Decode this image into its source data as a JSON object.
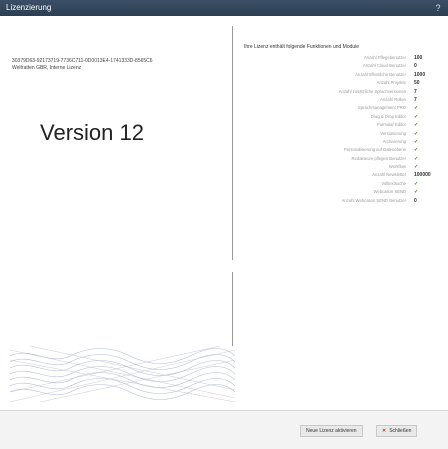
{
  "window": {
    "title": "Lizenzierung",
    "help_glyph": "?"
  },
  "license": {
    "key": "30379D63-92173719-7736C711-0D0013E4-1741333D-8565C6",
    "holder": "Weltratten GBR, Interne Lizenz"
  },
  "version_label": "Version 12",
  "features_header": "Ihre Lizenz enthält folgende Funktionen und Module",
  "features": [
    {
      "label": "Anzahl Pflegebenutzer",
      "value": "100"
    },
    {
      "label": "Anzahl Cloud-Benutzer",
      "value": "0"
    },
    {
      "label": "Anzahl öffentliche Benutzer",
      "value": "1000"
    },
    {
      "label": "Anzahl Projekte",
      "value": "50"
    },
    {
      "label": "Anzahl zusätzliche Sprachversionen",
      "value": "7"
    },
    {
      "label": "Anzahl Rollen",
      "value": "7"
    },
    {
      "label": "Sprachmanagement PRO",
      "value": "✓"
    },
    {
      "label": "Drag & Drop Editor",
      "value": "✓"
    },
    {
      "label": "Formular Editor",
      "value": "✓"
    },
    {
      "label": "Versionierung",
      "value": "✓"
    },
    {
      "label": "Archivierung",
      "value": "✓"
    },
    {
      "label": "Personalisierung auf Datenebene",
      "value": "✓"
    },
    {
      "label": "Redakteure pflegen Benutzer",
      "value": "✓"
    },
    {
      "label": "Workflow",
      "value": "✓"
    },
    {
      "label": "Anzahl Newsletter",
      "value": "100000"
    },
    {
      "label": "Volltextsuche",
      "value": "✓"
    },
    {
      "label": "Webcation SEND",
      "value": "✓"
    },
    {
      "label": "Anzahl Webcation SEND Benutzer",
      "value": "0"
    }
  ],
  "buttons": {
    "activate": "Neue Lizenz aktivieren",
    "close": "Schließen",
    "close_icon": "close-x-icon"
  },
  "colors": {
    "titlebar": "#2f4358",
    "check": "#4a7a1a"
  }
}
